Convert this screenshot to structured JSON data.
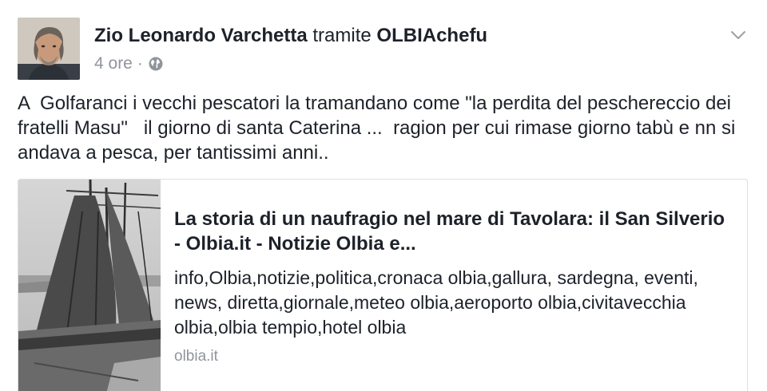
{
  "post": {
    "author": "Zio Leonardo Varchetta",
    "via_text": "tramite",
    "page_name": "OLBIAchefu",
    "time": "4 ore",
    "separator": "·",
    "privacy_icon": "globe-icon",
    "menu_icon": "chevron-down-icon",
    "text": "A  Golfaranci i vecchi pescatori la tramandano come \"la perdita del peschereccio dei fratelli Masu\"   il giorno di santa Caterina ...  ragion per cui rimase giorno tabù e nn si andava a pesca, per tantissimi anni.."
  },
  "link_card": {
    "title": "La storia di un naufragio nel mare di Tavolara: il San Silverio - Olbia.it - Notizie Olbia e...",
    "description": "info,Olbia,notizie,politica,cronaca olbia,gallura, sardegna, eventi, news, diretta,giornale,meteo olbia,aeroporto olbia,civitavecchia olbia,olbia tempio,hotel olbia",
    "domain": "olbia.it"
  },
  "colors": {
    "text": "#1d2129",
    "meta": "#90949c",
    "border": "#dddfe2"
  }
}
